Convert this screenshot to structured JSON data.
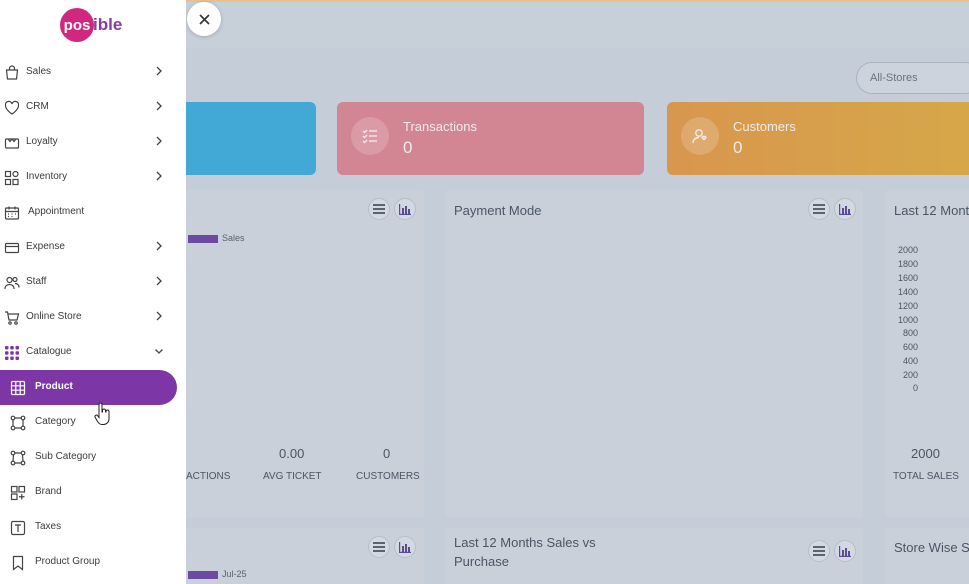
{
  "sidebar": {
    "logo": {
      "highlight": "pos",
      "rest": "ible"
    },
    "items": [
      {
        "label": "Sales",
        "icon": "shopping-bag-icon",
        "chevron": "right"
      },
      {
        "label": "CRM",
        "icon": "heart-icon",
        "chevron": "right"
      },
      {
        "label": "Loyalty",
        "icon": "gift-card-icon",
        "chevron": "right"
      },
      {
        "label": "Inventory",
        "icon": "boxes-icon",
        "chevron": "right"
      },
      {
        "label": "Appointment",
        "icon": "calendar-icon",
        "chevron": "none"
      },
      {
        "label": "Expense",
        "icon": "credit-card-icon",
        "chevron": "right"
      },
      {
        "label": "Staff",
        "icon": "people-icon",
        "chevron": "right"
      },
      {
        "label": "Online Store",
        "icon": "cart-icon",
        "chevron": "right"
      },
      {
        "label": "Catalogue",
        "icon": "grid-dots-icon",
        "chevron": "down"
      }
    ],
    "sub_items": [
      {
        "label": "Product",
        "icon": "product-grid-icon",
        "active": true
      },
      {
        "label": "Category",
        "icon": "category-nodes-icon",
        "active": false
      },
      {
        "label": "Sub Category",
        "icon": "sub-category-nodes-icon",
        "active": false
      },
      {
        "label": "Brand",
        "icon": "brand-layout-icon",
        "active": false
      },
      {
        "label": "Taxes",
        "icon": "taxes-t-icon",
        "active": false
      },
      {
        "label": "Product Group",
        "icon": "bookmark-icon",
        "active": false
      }
    ]
  },
  "dashboard": {
    "store_filter": "All-Stores",
    "stats": [
      {
        "label": "Transactions",
        "value": "0",
        "color": "#d28593"
      },
      {
        "label": "Customers",
        "value": "0",
        "color": "#d8964e"
      }
    ],
    "sales_panel": {
      "legend": "Sales",
      "metrics": [
        {
          "label": "ACTIONS",
          "value": ""
        },
        {
          "label": "AVG TICKET",
          "value": "0.00"
        },
        {
          "label": "CUSTOMERS",
          "value": "0"
        }
      ]
    },
    "payment_panel": {
      "title": "Payment Mode"
    },
    "last12_panel": {
      "title": "Last 12 Mont",
      "yticks": [
        "2000",
        "1800",
        "1600",
        "1400",
        "1200",
        "1000",
        "800",
        "600",
        "400",
        "200",
        "0"
      ],
      "metric_value": "2000",
      "metric_label": "TOTAL SALES"
    },
    "bottom_panels": [
      {
        "legend": "Jul-25"
      },
      {
        "title_line1": "Last 12 Months Sales vs",
        "title_line2": "Purchase"
      },
      {
        "title": "Store Wise S"
      }
    ]
  },
  "colors": {
    "accent": "#7d36a6",
    "brand_pink": "#d1277f"
  }
}
